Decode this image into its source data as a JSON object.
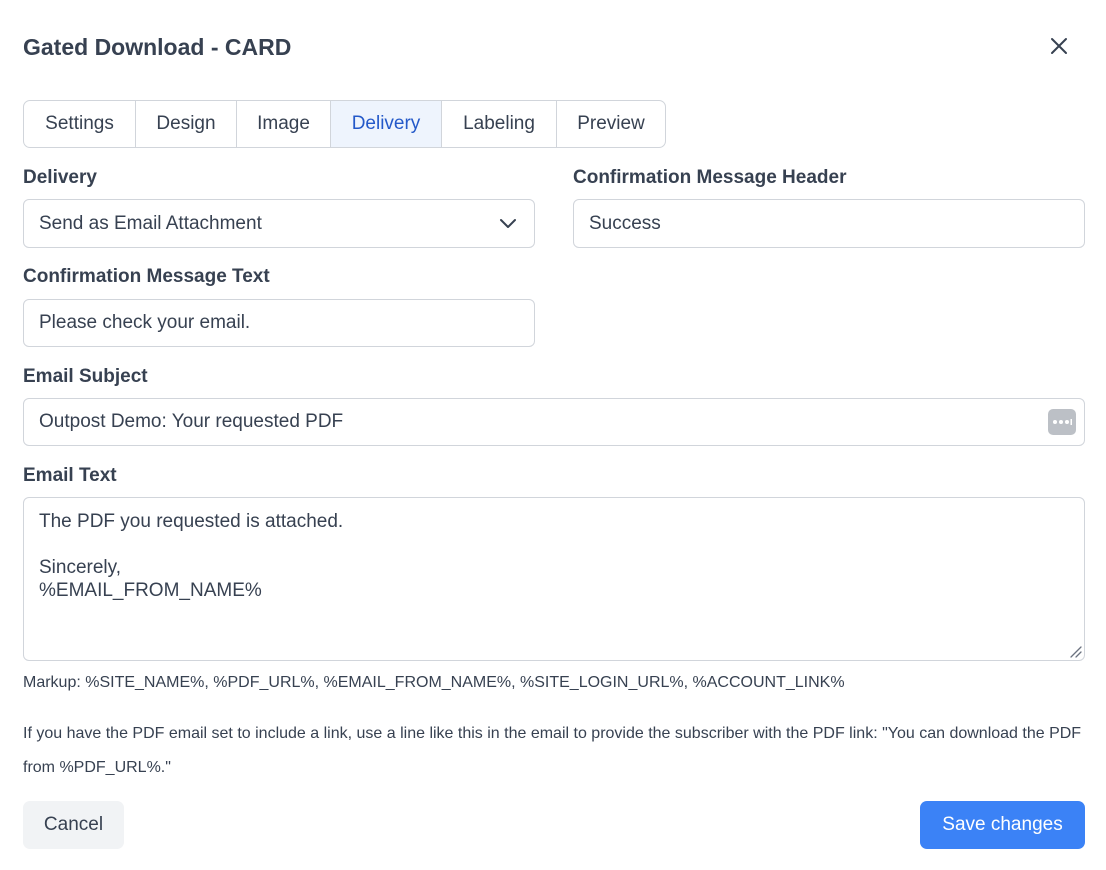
{
  "dialog": {
    "title": "Gated Download - CARD"
  },
  "tabs": [
    {
      "label": "Settings"
    },
    {
      "label": "Design"
    },
    {
      "label": "Image"
    },
    {
      "label": "Delivery"
    },
    {
      "label": "Labeling"
    },
    {
      "label": "Preview"
    }
  ],
  "active_tab": "Delivery",
  "form": {
    "delivery": {
      "label": "Delivery",
      "value": "Send as Email Attachment"
    },
    "confirmation_header": {
      "label": "Confirmation Message Header",
      "value": "Success"
    },
    "confirmation_text": {
      "label": "Confirmation Message Text",
      "value": "Please check your email."
    },
    "email_subject": {
      "label": "Email Subject",
      "value": "Outpost Demo: Your requested PDF"
    },
    "email_text": {
      "label": "Email Text",
      "lines": [
        "The PDF you requested is attached.",
        "",
        "Sincerely,",
        "%EMAIL_FROM_NAME%"
      ]
    }
  },
  "help": {
    "markup": "Markup: %SITE_NAME%, %PDF_URL%, %EMAIL_FROM_NAME%, %SITE_LOGIN_URL%, %ACCOUNT_LINK%",
    "link_hint": "If you have the PDF email set to include a link, use a line like this in the email to provide the subscriber with the PDF link: \"You can download the PDF from %PDF_URL%.\""
  },
  "footer": {
    "cancel_label": "Cancel",
    "save_label": "Save changes"
  },
  "icons": {
    "close": "close-icon",
    "select": "chevron-down-icon",
    "more": "more-options-icon",
    "resize": "resize-handle-icon"
  },
  "colors": {
    "accent": "#3b82f6",
    "active_tab_bg": "#eef4fd",
    "active_tab_text": "#2459c9",
    "border": "#d1d5db"
  }
}
